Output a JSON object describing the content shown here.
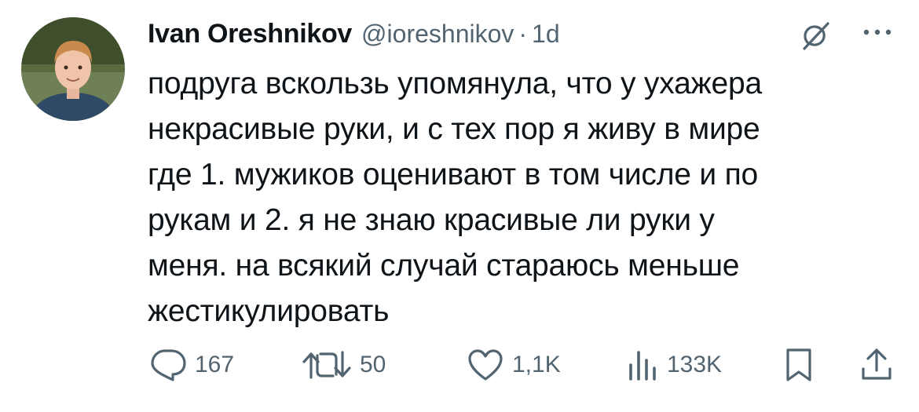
{
  "tweet": {
    "author_name": "Ivan Oreshnikov",
    "handle": "@ioreshnikov",
    "separator": "·",
    "time": "1d",
    "text": "подруга вскользь упомянула, что у ухажера\nнекрасивые руки, и с тех пор я живу в мире\nгде 1. мужиков оценивают в том числе и по\nрукам и 2. я не знаю красивые ли руки у\nменя. на всякий случай стараюсь меньше\nжестикулировать"
  },
  "actions": {
    "replies": "167",
    "reposts": "50",
    "likes": "1,1K",
    "views": "133K"
  },
  "icons": {
    "avatar": "avatar-photo",
    "grok": "grok-icon",
    "more": "more-icon",
    "reply": "reply-icon",
    "repost": "repost-icon",
    "like": "like-icon",
    "views": "views-icon",
    "bookmark": "bookmark-icon",
    "share": "share-icon"
  },
  "colors": {
    "text": "#0f1419",
    "secondary": "#536471",
    "background": "#ffffff"
  }
}
